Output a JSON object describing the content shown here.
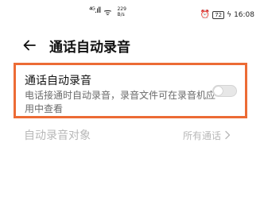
{
  "status_bar": {
    "signal": "⁴ᴳ.ıll",
    "wifi": "ᯤ",
    "speed_value": "229",
    "speed_unit": "B/s",
    "alarm_icon": "alarm-icon",
    "battery": "72",
    "time": "16:08"
  },
  "header": {
    "back_icon": "arrow-left-icon",
    "title": "通话自动录音"
  },
  "setting": {
    "title": "通话自动录音",
    "description": "电话接通时自动录音，录音文件可在录音机应用中查看",
    "enabled": false,
    "highlight_color": "#ec6b35"
  },
  "record_target": {
    "label": "自动录音对象",
    "value": "所有通话",
    "chevron_icon": "chevron-right-icon",
    "disabled": true
  }
}
